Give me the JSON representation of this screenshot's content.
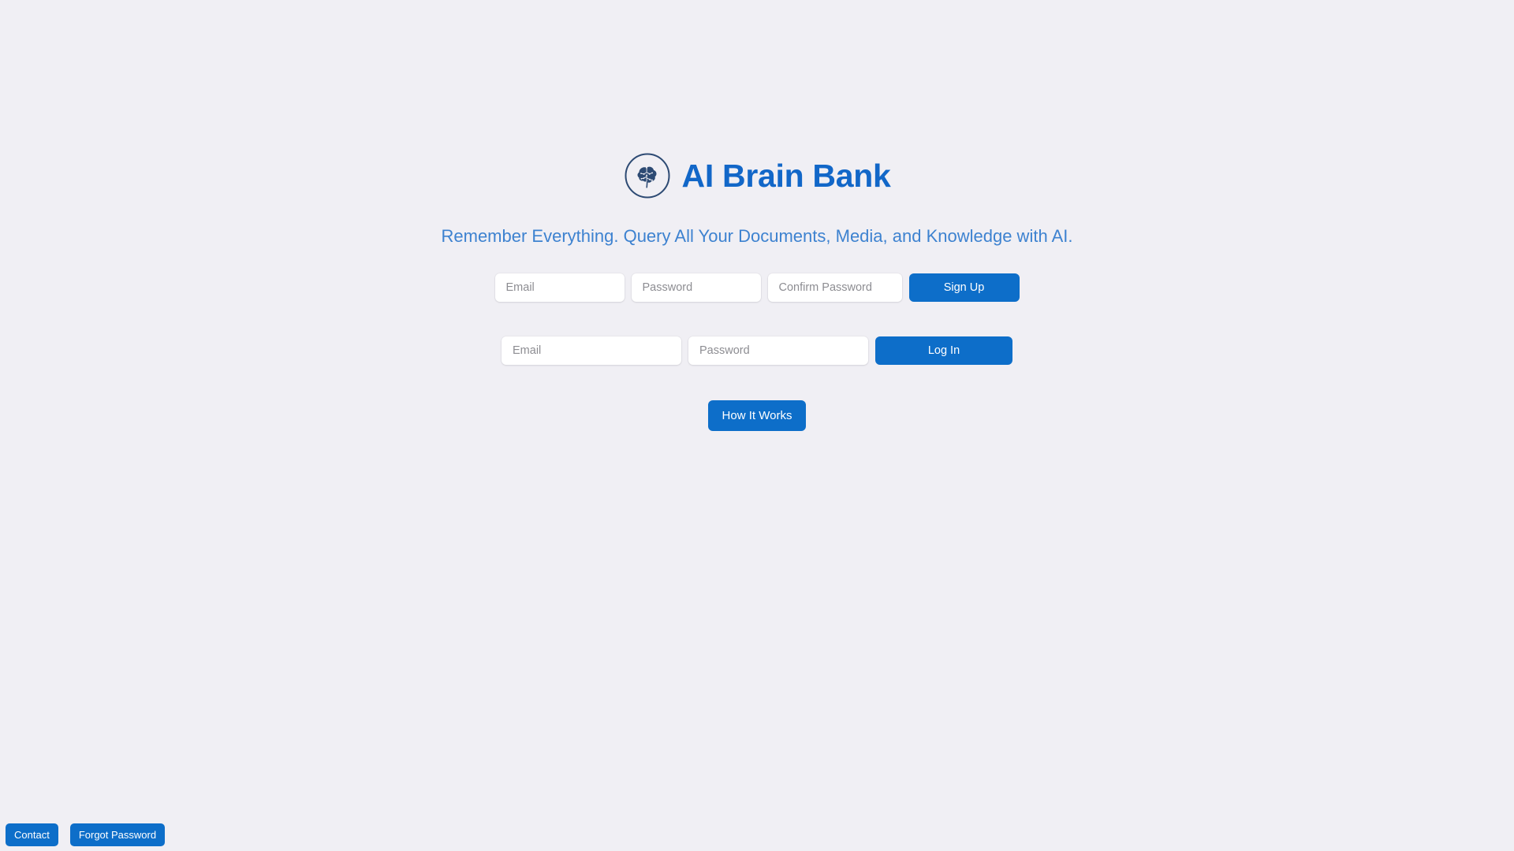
{
  "page": {
    "background_color": "#f0eff4"
  },
  "brand": {
    "logo_icon": "brain-circle-icon",
    "logo_color": "#2d4a73",
    "title": "AI Brain Bank",
    "title_color": "#1267c8"
  },
  "hero": {
    "tagline": "Remember Everything. Query All Your Documents, Media, and Knowledge with AI.",
    "tagline_color": "#3d82d0"
  },
  "signup_form": {
    "email": {
      "placeholder": "Email",
      "value": ""
    },
    "password": {
      "placeholder": "Password",
      "value": ""
    },
    "confirm_password": {
      "placeholder": "Confirm Password",
      "value": ""
    },
    "submit_label": "Sign Up"
  },
  "login_form": {
    "email": {
      "placeholder": "Email",
      "value": ""
    },
    "password": {
      "placeholder": "Password",
      "value": ""
    },
    "submit_label": "Log In"
  },
  "actions": {
    "how_it_works_label": "How It Works"
  },
  "footer": {
    "contact_label": "Contact",
    "forgot_password_label": "Forgot Password"
  },
  "colors": {
    "primary_blue": "#0d6ec9",
    "brand_blue": "#1267c8",
    "tagline_blue": "#3d82d0",
    "logo_navy": "#2d4a73",
    "background": "#f0eff4",
    "input_background": "#ffffff",
    "placeholder": "#8d8d92"
  }
}
